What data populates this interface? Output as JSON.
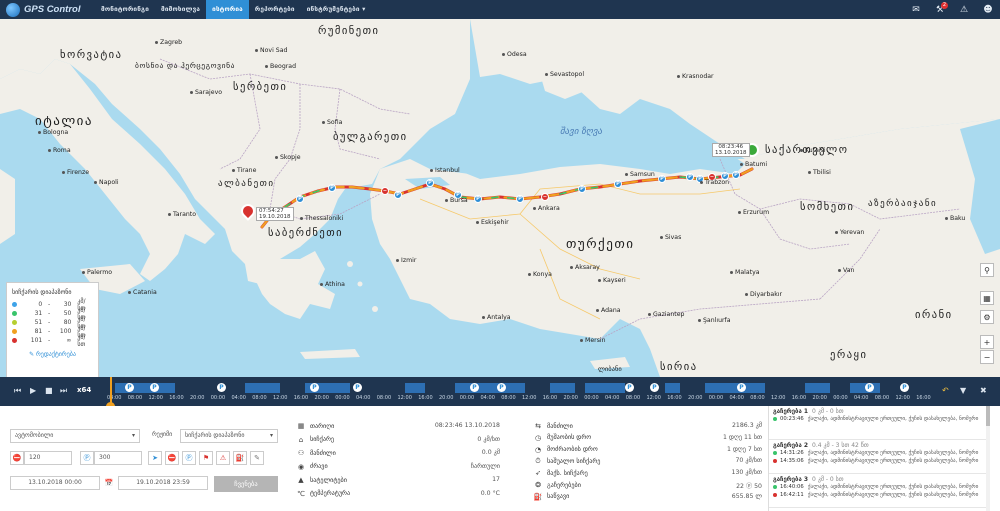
{
  "app": {
    "logo_text": "GPS Control"
  },
  "nav": {
    "items": [
      {
        "label": "მონიტორინგი",
        "active": false
      },
      {
        "label": "მიმოხილვა",
        "active": false
      },
      {
        "label": "ისტორია",
        "active": true
      },
      {
        "label": "რეპორტები",
        "active": false
      },
      {
        "label": "ინსტრუმენტები ▾",
        "active": false
      }
    ],
    "icons": [
      "chat-icon",
      "wrench-icon",
      "alert-icon",
      "user-icon"
    ],
    "notification_count": "2"
  },
  "map": {
    "countries": [
      "რუმინეთი",
      "ხორვატია",
      "ბოსნია და ჰერცეგოვინა",
      "სერბეთი",
      "იტალია",
      "ბულგარეთი",
      "ალბანეთი",
      "საბერძნეთი",
      "თურქეთი",
      "საქართველო",
      "სომხეთი",
      "აზერბაიჯანი",
      "ირანი",
      "ერაყი",
      "სირია",
      "ლიბანი"
    ],
    "seas": [
      "შავი ზღვა"
    ],
    "cities": [
      "Zagreb",
      "Novi Sad",
      "Beograd",
      "Sarajevo",
      "Skopje",
      "Tirane",
      "Sofia",
      "Napoli",
      "Roma",
      "Palermo",
      "Catania",
      "Taranto",
      "Istanbul",
      "Ankara",
      "Bursa",
      "Izmir",
      "Antalya",
      "Konya",
      "Kayseri",
      "Sivas",
      "Samsun",
      "Trabzon",
      "Erzurum",
      "Van",
      "Diyarbakır",
      "Gaziantep",
      "Şanlıurfa",
      "Adana",
      "Mersin",
      "Batumi",
      "Kutaisi",
      "Yerevan",
      "Baku",
      "Odesa",
      "Sevastopol",
      "Krasnodar",
      "Tbilisi",
      "Athina",
      "Thessaloniki",
      "Bologna",
      "Firenze",
      "Eskişehir",
      "Malatya",
      "Aksaray"
    ],
    "start_marker": {
      "time": "08:23:46",
      "date": "13.10.2018"
    },
    "end_marker": {
      "time": "07:54:27",
      "date": "19.10.2018"
    }
  },
  "legend": {
    "title": "სიჩქარის დიაპაზონი",
    "rows": [
      {
        "color": "#3fa3e8",
        "min": "0",
        "max": "30",
        "unit": "კმ/სთ"
      },
      {
        "color": "#39c46b",
        "min": "31",
        "max": "50",
        "unit": "კმ/სთ"
      },
      {
        "color": "#b6cf30",
        "min": "51",
        "max": "80",
        "unit": "კმ/სთ"
      },
      {
        "color": "#f0a020",
        "min": "81",
        "max": "100",
        "unit": "კმ/სთ"
      },
      {
        "color": "#d8322f",
        "min": "101",
        "max": "∞",
        "unit": "კმ/სთ"
      }
    ],
    "edit_label": "რედაქტირება"
  },
  "timeline": {
    "speed": "x64",
    "hours": [
      "04:00",
      "08:00",
      "12:00",
      "16:00",
      "20:00",
      "00:00",
      "04:00",
      "08:00",
      "12:00",
      "16:00",
      "20:00",
      "00:00",
      "04:00",
      "08:00",
      "12:00",
      "16:00",
      "20:00",
      "00:00",
      "04:00",
      "08:00",
      "12:00",
      "16:00",
      "20:00",
      "00:00",
      "04:00",
      "08:00",
      "12:00",
      "16:00",
      "20:00",
      "00:00",
      "04:00",
      "08:00",
      "12:00",
      "16:00",
      "20:00",
      "00:00",
      "04:00",
      "08:00",
      "12:00",
      "16:00"
    ]
  },
  "controls": {
    "object_placeholder": "ავტომობილი",
    "mode_label": "რეჟიმი",
    "mode_value": "სიჩქარის დიაპაზონი",
    "stop_minutes": "120",
    "parking_minutes": "300",
    "date_from": "13.10.2018 00:00",
    "date_to": "19.10.2018 23:59",
    "show_button": "ჩვენება"
  },
  "stats_left": [
    {
      "icon": "▦",
      "label": "თარიღი",
      "value": "08:23:46 13.10.2018"
    },
    {
      "icon": "⌂",
      "label": "სიჩქარე",
      "value": "0 კმ/სთ"
    },
    {
      "icon": "⚇",
      "label": "მანძილი",
      "value": "0.0 კმ"
    },
    {
      "icon": "◉",
      "label": "ძრავი",
      "value": "ჩართული"
    },
    {
      "icon": "▲",
      "label": "სატელიტები",
      "value": "17"
    },
    {
      "icon": "℃",
      "label": "ტემპერატურა",
      "value": "0.0 °C"
    }
  ],
  "stats_right": [
    {
      "icon": "⇆",
      "label": "მანძილი",
      "value": "2186.3 კმ"
    },
    {
      "icon": "◷",
      "label": "მუშაობის დრო",
      "value": "1 დღე 11 სთ"
    },
    {
      "icon": "◔",
      "label": "მოძრაობის დრო",
      "value": "1 დღე 7 სთ"
    },
    {
      "icon": "⏱",
      "label": "საშუალო სიჩქარე",
      "value": "70 კმ/სთ"
    },
    {
      "icon": "➶",
      "label": "მაქს. სიჩქარე",
      "value": "130 კმ/სთ"
    },
    {
      "icon": "❂",
      "label": "გაჩერებები",
      "value": "22 ⓟ 50"
    },
    {
      "icon": "⛽",
      "label": "საწვავი",
      "value": "655.85 ლ"
    }
  ],
  "stops": [
    {
      "title": "გაჩერება 1",
      "meta": "0 კმ - 0 სთ",
      "start": "00:23:46",
      "end": "",
      "address": "ქალაქი, ადმინისტრაციული ერთეული, ქუჩის დასახელება, ნომერი"
    },
    {
      "title": "გაჩერება 2",
      "meta": "0.4 კმ - 3 სთ 42 წთ",
      "start": "14:31:26",
      "end": "14:35:06",
      "address": "ქალაქი, ადმინისტრაციული ერთეული, ქუჩის დასახელება, ნომერი"
    },
    {
      "title": "გაჩერება 3",
      "meta": "0 კმ - 0 სთ",
      "start": "16:40:06",
      "end": "16:42:11",
      "address": "ქალაქი, ადმინისტრაციული ერთეული, ქუჩის დასახელება, ნომერი"
    }
  ]
}
